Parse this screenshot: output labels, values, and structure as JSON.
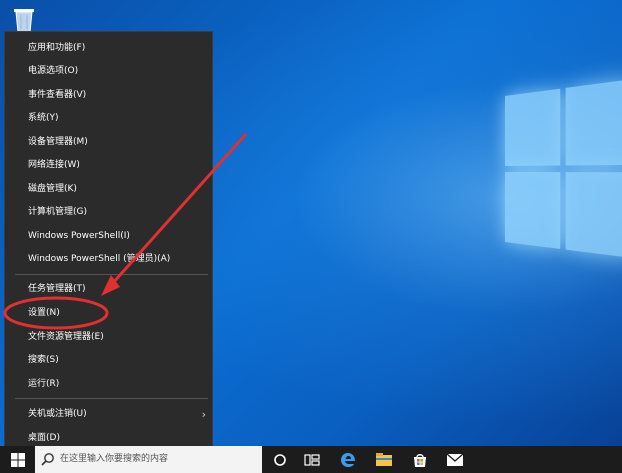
{
  "menu": {
    "items": [
      {
        "label": "应用和功能(F)"
      },
      {
        "label": "电源选项(O)"
      },
      {
        "label": "事件查看器(V)"
      },
      {
        "label": "系统(Y)"
      },
      {
        "label": "设备管理器(M)"
      },
      {
        "label": "网络连接(W)"
      },
      {
        "label": "磁盘管理(K)"
      },
      {
        "label": "计算机管理(G)"
      },
      {
        "label": "Windows PowerShell(I)"
      },
      {
        "label": "Windows PowerShell (管理员)(A)"
      },
      {
        "label": "任务管理器(T)"
      },
      {
        "label": "设置(N)"
      },
      {
        "label": "文件资源管理器(E)"
      },
      {
        "label": "搜索(S)"
      },
      {
        "label": "运行(R)"
      },
      {
        "label": "关机或注销(U)",
        "has_submenu": true
      },
      {
        "label": "桌面(D)"
      }
    ],
    "submenu_arrow": "›"
  },
  "taskbar": {
    "search_placeholder": "在这里输入你要搜索的内容",
    "icons": [
      "windows-start-icon",
      "search-icon",
      "cortana-circle-icon",
      "task-view-icon",
      "edge-browser-icon",
      "file-explorer-icon",
      "store-icon",
      "mail-icon"
    ]
  },
  "colors": {
    "menu_bg": "#2b2b2b",
    "menu_text": "#ffffff",
    "annotation_red": "#e03030",
    "taskbar_bg": "#1c1c1c",
    "desktop_blue": "#0b6fd3"
  }
}
